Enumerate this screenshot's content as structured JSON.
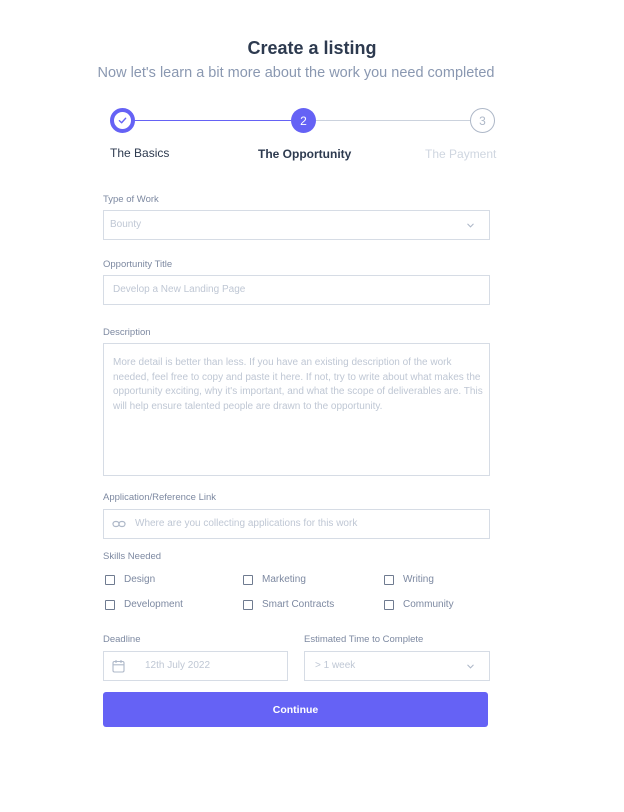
{
  "header": {
    "title": "Create a listing",
    "subtitle": "Now let's learn a bit more about the work you need completed"
  },
  "stepper": {
    "steps": [
      {
        "label": "The Basics",
        "number": "1",
        "state": "completed"
      },
      {
        "label": "The Opportunity",
        "number": "2",
        "state": "current"
      },
      {
        "label": "The Payment",
        "number": "3",
        "state": "upcoming"
      }
    ]
  },
  "form": {
    "type_of_work": {
      "label": "Type of Work",
      "placeholder": "Bounty",
      "icon": "chevron-down-icon"
    },
    "opportunity_title": {
      "label": "Opportunity Title",
      "placeholder": "Develop a New Landing Page"
    },
    "description": {
      "label": "Description",
      "placeholder": "More detail is better than less. If you have an existing description of the work needed, feel free to copy and paste it here. If not, try to write about what makes the opportunity exciting, why it's important, and what the scope of deliverables are. This will help ensure talented people are drawn to the opportunity."
    },
    "application_link": {
      "label": "Application/Reference Link",
      "placeholder": "Where are you collecting applications for this work",
      "icon": "link-icon"
    },
    "skills": {
      "label": "Skills Needed",
      "options": [
        {
          "label": "Design",
          "checked": false
        },
        {
          "label": "Marketing",
          "checked": false
        },
        {
          "label": "Writing",
          "checked": false
        },
        {
          "label": "Development",
          "checked": false
        },
        {
          "label": "Smart Contracts",
          "checked": false
        },
        {
          "label": "Community",
          "checked": false
        }
      ]
    },
    "deadline": {
      "label": "Deadline",
      "placeholder": "12th July 2022",
      "icon": "calendar-icon"
    },
    "estimated_time": {
      "label": "Estimated Time to Complete",
      "placeholder": "> 1 week",
      "icon": "chevron-down-icon"
    },
    "continue_label": "Continue"
  },
  "colors": {
    "accent": "#6562f5",
    "title": "#2d3a4f",
    "muted": "#8a98b1",
    "placeholder": "#bfc7d4",
    "border": "#d6dce5"
  }
}
